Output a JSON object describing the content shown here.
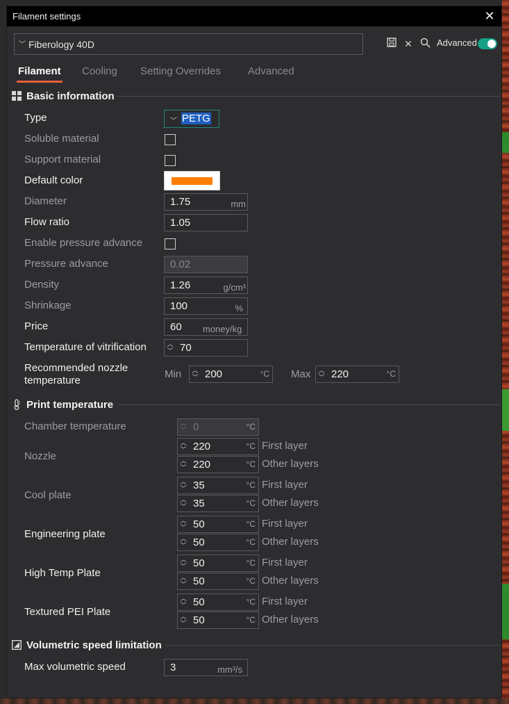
{
  "window": {
    "title": "Filament settings"
  },
  "preset": {
    "name": "Fiberology 40D",
    "advanced_label": "Advanced",
    "advanced_on": true
  },
  "tabs": [
    "Filament",
    "Cooling",
    "Setting Overrides",
    "Advanced"
  ],
  "sections": {
    "basic": "Basic information",
    "print_temp": "Print temperature",
    "volumetric": "Volumetric speed limitation"
  },
  "basic": {
    "type_label": "Type",
    "type_value": "PETG",
    "soluble_label": "Soluble material",
    "support_label": "Support material",
    "default_color_label": "Default color",
    "default_color": "#ff8000",
    "diameter_label": "Diameter",
    "diameter_value": "1.75",
    "diameter_unit": "mm",
    "flow_label": "Flow ratio",
    "flow_value": "1.05",
    "enable_pa_label": "Enable pressure advance",
    "pa_label": "Pressure advance",
    "pa_value": "0.02",
    "density_label": "Density",
    "density_value": "1.26",
    "density_unit": "g/cm³",
    "shrinkage_label": "Shrinkage",
    "shrinkage_value": "100",
    "shrinkage_unit": "%",
    "price_label": "Price",
    "price_value": "60",
    "price_unit": "money/kg",
    "vitrification_label": "Temperature of vitrification",
    "vitrification_value": "70",
    "nozzle_temp_label": "Recommended nozzle temperature",
    "min_label": "Min",
    "min_value": "200",
    "max_label": "Max",
    "max_value": "220",
    "celsius": "°C"
  },
  "print_temp": {
    "chamber_label": "Chamber temperature",
    "chamber_value": "0",
    "first_layer": "First layer",
    "other_layers": "Other layers",
    "nozzle_label": "Nozzle",
    "nozzle_first": "220",
    "nozzle_other": "220",
    "cool_label": "Cool plate",
    "cool_first": "35",
    "cool_other": "35",
    "eng_label": "Engineering plate",
    "eng_first": "50",
    "eng_other": "50",
    "high_label": "High Temp Plate",
    "high_first": "50",
    "high_other": "50",
    "tex_label": "Textured PEI Plate",
    "tex_first": "50",
    "tex_other": "50"
  },
  "volumetric": {
    "max_label": "Max volumetric speed",
    "max_value": "3",
    "max_unit": "mm³/s"
  }
}
